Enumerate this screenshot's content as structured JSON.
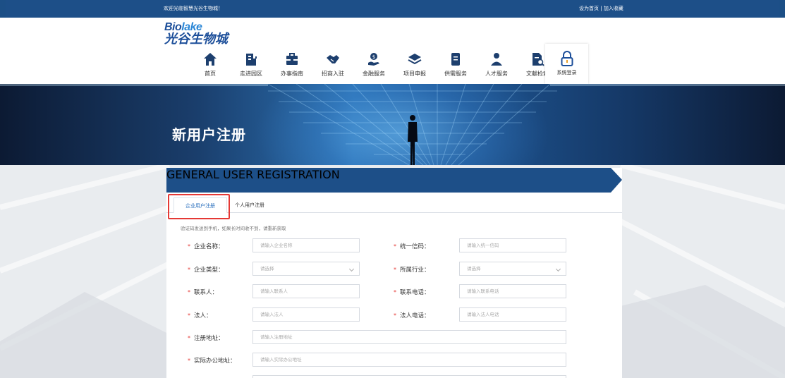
{
  "topbar": {
    "welcome": "欢迎光临智慧光谷生物城！",
    "set_home": "设为首页",
    "separator": " | ",
    "add_favorite": "加入收藏"
  },
  "logo": {
    "en_part1": "Bio",
    "en_part2": "lake",
    "cn": "光谷生物城"
  },
  "nav": {
    "items": [
      {
        "label": "首页",
        "icon": "home-icon"
      },
      {
        "label": "走进园区",
        "icon": "building-icon"
      },
      {
        "label": "办事指南",
        "icon": "briefcase-icon"
      },
      {
        "label": "招商入驻",
        "icon": "handshake-icon"
      },
      {
        "label": "金融服务",
        "icon": "hand-coin-icon"
      },
      {
        "label": "项目申报",
        "icon": "layers-icon"
      },
      {
        "label": "供需服务",
        "icon": "document-icon"
      },
      {
        "label": "人才服务",
        "icon": "person-icon"
      },
      {
        "label": "文献检索",
        "icon": "doc-search-icon"
      }
    ],
    "login": {
      "label": "系统登录",
      "icon": "lock-icon"
    }
  },
  "banner": {
    "title": "新用户注册"
  },
  "form": {
    "ribbon_title": "GENERAL USER REGISTRATION",
    "tabs": [
      "企业用户注册",
      "个人用户注册"
    ],
    "active_tab": 0,
    "hint": "验证码发送到手机，如果长时间收不到，请重新获取",
    "fields": {
      "company_name": {
        "label": "企业名称：",
        "placeholder": "请输入企业名称"
      },
      "credit_code": {
        "label": "统一信码：",
        "placeholder": "请输入统一信码"
      },
      "company_type": {
        "label": "企业类型：",
        "placeholder": "请选择"
      },
      "industry": {
        "label": "所属行业：",
        "placeholder": "请选择"
      },
      "contact": {
        "label": "联系人：",
        "placeholder": "请输入联系人"
      },
      "contact_phone": {
        "label": "联系电话：",
        "placeholder": "请输入联系电话"
      },
      "legal_person": {
        "label": "法人：",
        "placeholder": "请输入法人"
      },
      "legal_phone": {
        "label": "法人电话：",
        "placeholder": "请输入法人电话"
      },
      "reg_address": {
        "label": "注册地址：",
        "placeholder": "请输入注册地址"
      },
      "office_address": {
        "label": "实际办公地址：",
        "placeholder": "请输入实际办公地址"
      }
    },
    "required_mark": "*"
  },
  "colors": {
    "primary": "#1d4f88",
    "accent": "#2a6fbd",
    "required": "#e53935",
    "highlight": "#e53935"
  }
}
